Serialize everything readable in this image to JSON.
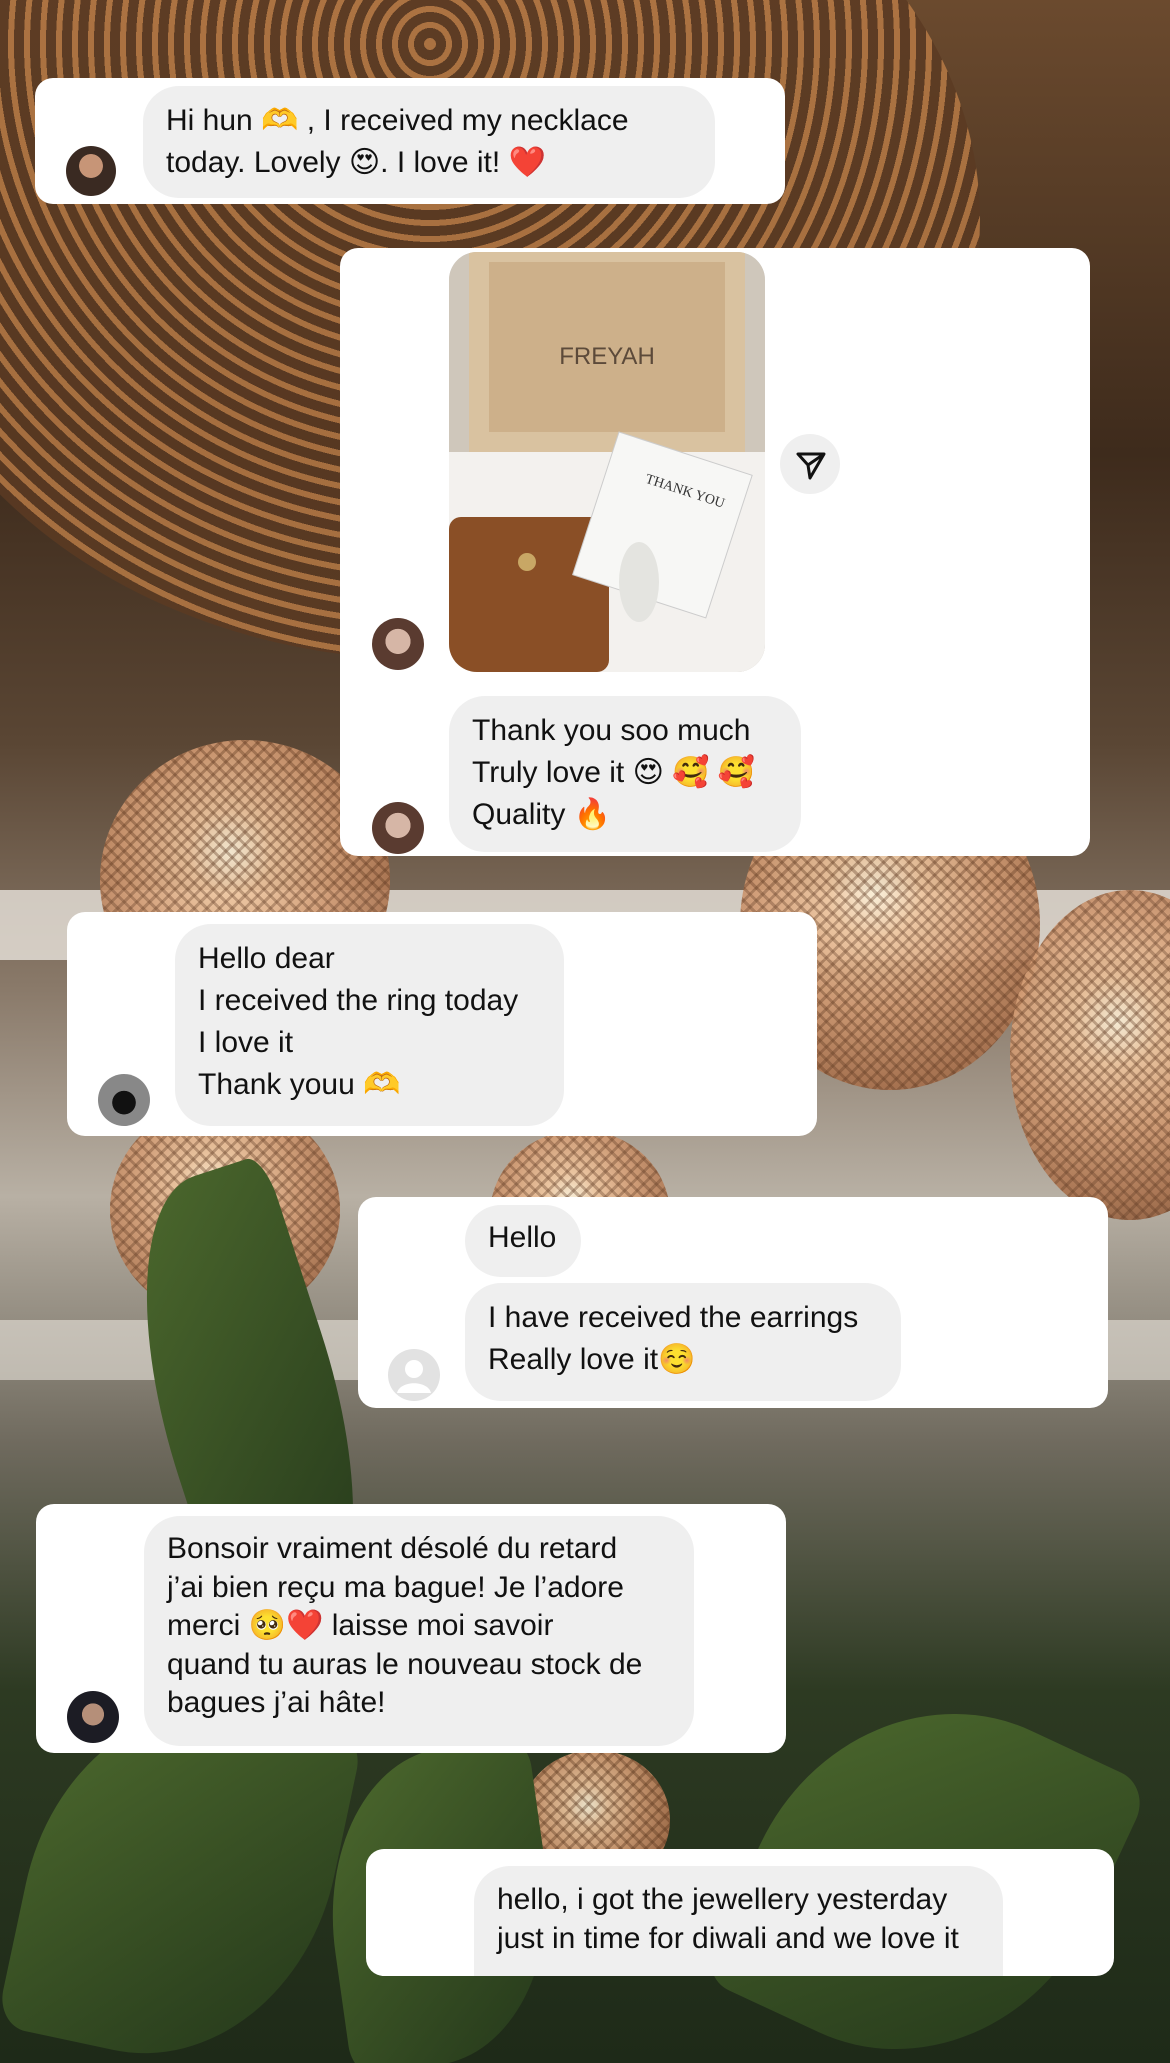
{
  "messages": [
    {
      "lines": [
        "Hi hun 🫶 , I received my necklace",
        "today. Lovely 😍. I love it! ❤️"
      ]
    },
    {
      "image": {
        "box_text": "FREYAH",
        "card_text": "THANK YOU"
      },
      "share_icon": "send-icon",
      "lines": [
        "Thank you soo much",
        "Truly love it 😍 🥰 🥰",
        "Quality 🔥"
      ]
    },
    {
      "lines": [
        "Hello dear",
        "I received the ring today",
        "I love it",
        "Thank youu 🫶"
      ]
    },
    {
      "bubble_a": [
        "Hello"
      ],
      "bubble_b": [
        "I have received the earrings",
        "Really love it☺️"
      ]
    },
    {
      "lines": [
        "Bonsoir vraiment désolé du retard",
        "j’ai bien reçu ma bague! Je l’adore",
        "merci 🥺❤️ laisse moi savoir",
        "quand tu auras le nouveau stock de",
        "bagues j’ai hâte!"
      ]
    },
    {
      "lines": [
        "hello, i got the jewellery yesterday",
        "just in time for diwali and we love it"
      ]
    }
  ],
  "colors": {
    "bubble": "#efefef",
    "card": "#ffffff"
  }
}
